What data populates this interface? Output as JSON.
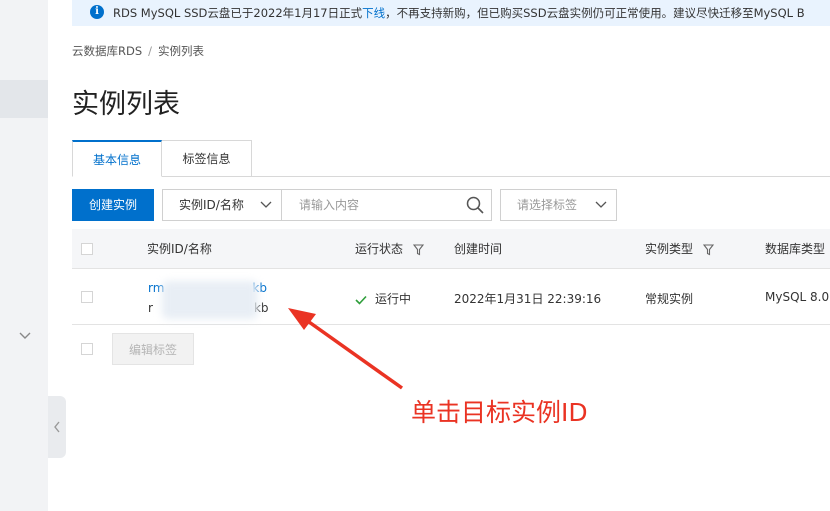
{
  "notice": {
    "icon": "info-icon",
    "text_before": "RDS MySQL SSD云盘已于2022年1月17日正式",
    "link": "下线",
    "text_after": "，不再支持新购，但已购买SSD云盘实例仍可正常使用。建议尽快迁移至MySQL B"
  },
  "breadcrumb": {
    "root": "云数据库RDS",
    "separator": "/",
    "current": "实例列表"
  },
  "page_title": "实例列表",
  "tabs": [
    {
      "label": "基本信息",
      "active": true
    },
    {
      "label": "标签信息",
      "active": false
    }
  ],
  "toolbar": {
    "create_label": "创建实例",
    "search_field": "实例ID/名称",
    "search_placeholder": "请输入内容",
    "tag_placeholder": "请选择标签"
  },
  "table": {
    "columns": [
      "实例ID/名称",
      "运行状态",
      "创建时间",
      "实例类型",
      "数据库类型"
    ],
    "rows": [
      {
        "id_prefix": "rm",
        "id_suffix": "kb",
        "name_prefix": "r",
        "name_suffix": "kb",
        "status": "运行中",
        "created": "2022年1月31日 22:39:16",
        "type": "常规实例",
        "db_type": "MySQL 8.0"
      }
    ]
  },
  "edit_tags_label": "编辑标签",
  "annotation": "单击目标实例ID",
  "colors": {
    "primary": "#0070cc",
    "annotation": "#ea3323",
    "status_ok": "#2e9e3a"
  }
}
